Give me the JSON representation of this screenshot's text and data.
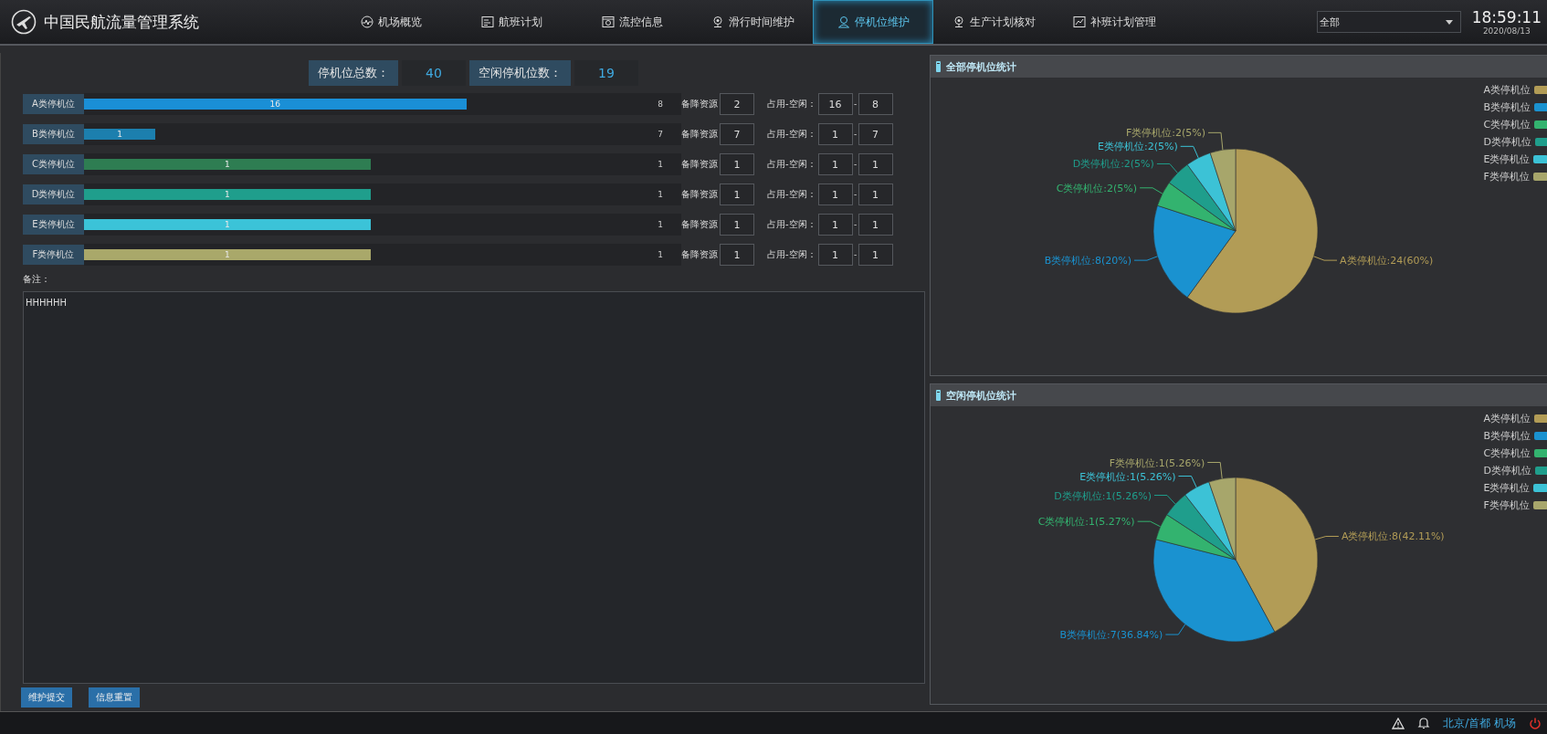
{
  "header": {
    "title": "中国民航流量管理系统",
    "nav": [
      {
        "label": "机场概览",
        "selected": false
      },
      {
        "label": "航班计划",
        "selected": false
      },
      {
        "label": "流控信息",
        "selected": false
      },
      {
        "label": "滑行时间维护",
        "selected": false
      },
      {
        "label": "停机位维护",
        "selected": true
      },
      {
        "label": "生产计划核对",
        "selected": false
      },
      {
        "label": "补班计划管理",
        "selected": false
      }
    ],
    "airport_select": {
      "value": "全部"
    },
    "time": "18:59:11",
    "date": "2020/08/13"
  },
  "summary": [
    {
      "label": "停机位总数：",
      "value": "40"
    },
    {
      "label": "空闲停机位数：",
      "value": "19"
    }
  ],
  "stand_rows": [
    {
      "label": "A类停机位",
      "level": 0.64,
      "bar_value": "16",
      "count": "8",
      "color": "#1a8fd6",
      "backup_label": "备降资源",
      "backup_value": "2",
      "occupancy_label": "占用-空闲：",
      "occupied": "16",
      "separator": "-",
      "free": "8"
    },
    {
      "label": "B类停机位",
      "level": 0.12,
      "bar_value": "1",
      "count": "7",
      "color": "#1c7fae",
      "backup_label": "备降资源",
      "backup_value": "7",
      "occupancy_label": "占用-空闲：",
      "occupied": "1",
      "separator": "-",
      "free": "7"
    },
    {
      "label": "C类停机位",
      "level": 0.48,
      "bar_value": "1",
      "count": "1",
      "color": "#2e7d52",
      "backup_label": "备降资源",
      "backup_value": "1",
      "occupancy_label": "占用-空闲：",
      "occupied": "1",
      "separator": "-",
      "free": "1"
    },
    {
      "label": "D类停机位",
      "level": 0.48,
      "bar_value": "1",
      "count": "1",
      "color": "#1f9e8c",
      "backup_label": "备降资源",
      "backup_value": "1",
      "occupancy_label": "占用-空闲：",
      "occupied": "1",
      "separator": "-",
      "free": "1"
    },
    {
      "label": "E类停机位",
      "level": 0.48,
      "bar_value": "1",
      "count": "1",
      "color": "#3bc3d8",
      "backup_label": "备降资源",
      "backup_value": "1",
      "occupancy_label": "占用-空闲：",
      "occupied": "1",
      "separator": "-",
      "free": "1"
    },
    {
      "label": "F类停机位",
      "level": 0.48,
      "bar_value": "1",
      "count": "1",
      "color": "#a9a86a",
      "backup_label": "备降资源",
      "backup_value": "1",
      "occupancy_label": "占用-空闲：",
      "occupied": "1",
      "separator": "-",
      "free": "1"
    }
  ],
  "remarks": {
    "label": "备注：",
    "value": "HHHHHH"
  },
  "buttons": [
    "维护提交",
    "信息重置"
  ],
  "charts": [
    {
      "title": "全部停机位统计",
      "slices": [
        {
          "color": "#b29c56"
        },
        {
          "color": "#1a92d0"
        },
        {
          "color": "#33b36f"
        },
        {
          "color": "#1f9e8c"
        },
        {
          "color": "#3cc2d6"
        },
        {
          "color": "#a7a66b"
        }
      ],
      "chart_data": {
        "type": "pie",
        "categories": [
          "A类停机位",
          "B类停机位",
          "C类停机位",
          "D类停机位",
          "E类停机位",
          "F类停机位"
        ],
        "series": [
          {
            "values": [
              60,
              20,
              5,
              5,
              5,
              5
            ]
          }
        ],
        "legend": true,
        "value_labels": [
          "A类停机位:24(60%)",
          "B类停机位:8(20%)",
          "C类停机位:2(5%)",
          "D类停机位:2(5%)",
          "E类停机位:2(5%)",
          "F类停机位:2(5%)"
        ]
      }
    },
    {
      "title": "空闲停机位统计",
      "slices": [
        {
          "color": "#b29c56"
        },
        {
          "color": "#1a92d0"
        },
        {
          "color": "#33b36f"
        },
        {
          "color": "#1f9e8c"
        },
        {
          "color": "#3cc2d6"
        },
        {
          "color": "#a7a66b"
        }
      ],
      "chart_data": {
        "type": "pie",
        "categories": [
          "A类停机位",
          "B类停机位",
          "C类停机位",
          "D类停机位",
          "E类停机位",
          "F类停机位"
        ],
        "series": [
          {
            "values": [
              42.11,
              36.84,
              5.27,
              5.26,
              5.26,
              5.26
            ]
          }
        ],
        "legend": true,
        "value_labels": [
          "A类停机位:8(42.11%)",
          "B类停机位:7(36.84%)",
          "C类停机位:1(5.27%)",
          "D类停机位:1(5.26%)",
          "E类停机位:1(5.26%)",
          "F类停机位:1(5.26%)"
        ]
      }
    }
  ],
  "status_bar": {
    "location": "北京/首都 机场"
  }
}
